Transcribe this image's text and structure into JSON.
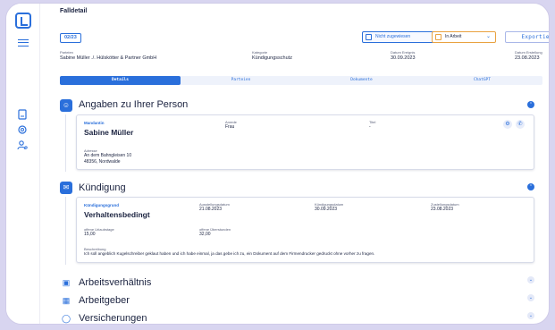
{
  "page": {
    "title": "Falldetail"
  },
  "header": {
    "case_number": "02/23",
    "assignee": "Nicht zugewiesen",
    "status": "In Arbeit",
    "export_label": "Exportieren",
    "meta": {
      "parties_label": "Parteien",
      "parties_value": "Sabine Müller ./. Hülskötter & Partner GmbH",
      "category_label": "Kategorie",
      "category_value": "Kündigungsschutz",
      "event_date_label": "Datum Ereignis",
      "event_date_value": "30.09.2023",
      "created_label": "Datum Erstellung",
      "created_value": "23.08.2023"
    }
  },
  "tabs": [
    "Details",
    "Parteien",
    "Dokumente",
    "ChatGPT"
  ],
  "sections": {
    "person": {
      "title": "Angaben zu Ihrer Person",
      "client_label": "Mandantin",
      "client_name": "Sabine Müller",
      "salutation_label": "Anrede",
      "salutation_value": "Frau",
      "title_label": "Titel",
      "title_value": "-",
      "address_label": "Adresse",
      "address_line1": "An dem Bahngleisen 10",
      "address_line2": "48356, Nordwalde"
    },
    "termination": {
      "title": "Kündigung",
      "reason_label": "Kündigungsgrund",
      "reason_value": "Verhaltensbedingt",
      "issued_label": "Ausstellungsdatum",
      "issued_value": "21.08.2023",
      "termination_date_label": "Kündigungsdatum",
      "termination_date_value": "30.09.2023",
      "delivery_label": "Zustellungsdatum",
      "delivery_value": "23.08.2023",
      "vacation_label": "offene Urlaubstage",
      "vacation_value": "15,00",
      "overtime_label": "offene Überstunden",
      "overtime_value": "32,00",
      "description_label": "Beschreibung",
      "description_value": "Ich soll angeblich Kugelschreiber geklaut haben und ich habe einmal, ja das gebe ich zu, ein Dokument auf dem Firmendrucker gedruckt ohne vorher zu fragen."
    },
    "employment": {
      "title": "Arbeitsverhältnis"
    },
    "employer": {
      "title": "Arbeitgeber"
    },
    "insurance": {
      "title": "Versicherungen"
    }
  },
  "icons": {
    "logo": "app-logo",
    "menu": "hamburger-menu-icon",
    "nav": [
      "document-icon",
      "settings-icon",
      "user-settings-icon"
    ]
  },
  "colors": {
    "accent": "#2a6fdb",
    "status_orange": "#e9a240",
    "background": "#d8d5f0"
  }
}
